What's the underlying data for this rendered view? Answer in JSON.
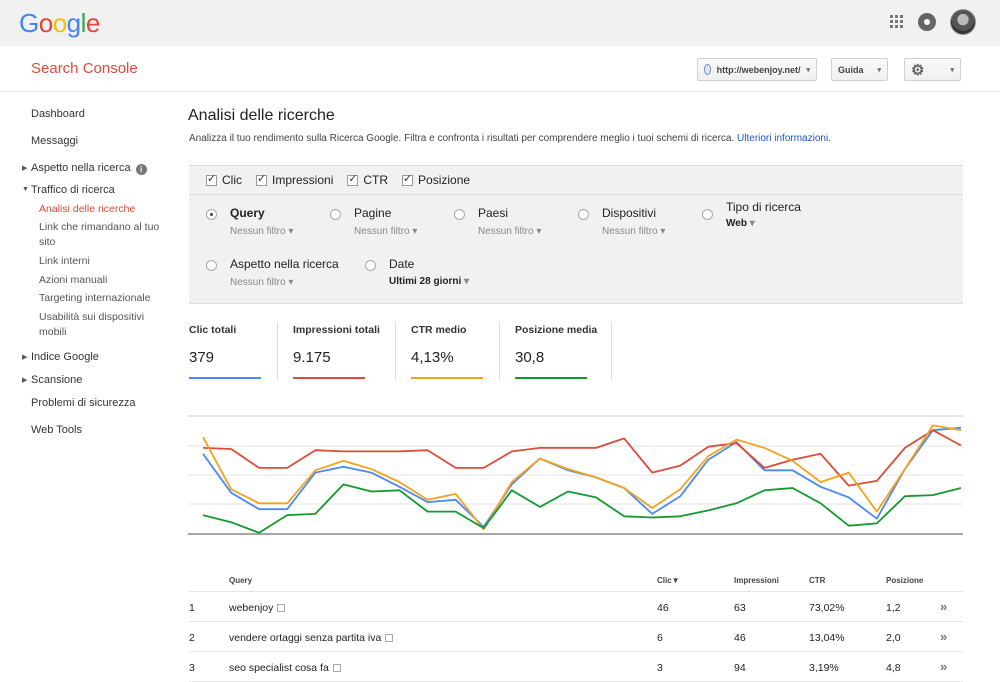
{
  "header": {
    "logo": [
      "G",
      "o",
      "o",
      "g",
      "l",
      "e"
    ],
    "logo_colors": [
      "#4285f4",
      "#ea4335",
      "#fbbc05",
      "#4285f4",
      "#34a853",
      "#ea4335"
    ],
    "icons": [
      "apps-grid-icon",
      "notifications-icon",
      "account-avatar"
    ]
  },
  "subheader": {
    "product": "Search Console",
    "site": "http://webenjoy.net/",
    "help": "Guida",
    "settings_icon": "gear-icon"
  },
  "sidebar": {
    "items": [
      {
        "label": "Dashboard"
      },
      {
        "label": "Messaggi"
      },
      {
        "label": "Aspetto nella ricerca"
      },
      {
        "label": "Traffico di ricerca"
      },
      {
        "label": "Analisi delle ricerche"
      },
      {
        "label": "Link che rimandano al tuo"
      },
      {
        "label": "sito"
      },
      {
        "label": "Link interni"
      },
      {
        "label": "Azioni manuali"
      },
      {
        "label": "Targeting internazionale"
      },
      {
        "label": "Usabilità sui dispositivi"
      },
      {
        "label": "mobili"
      },
      {
        "label": "Indice Google"
      },
      {
        "label": "Scansione"
      },
      {
        "label": "Problemi di sicurezza"
      },
      {
        "label": "Web Tools"
      }
    ],
    "info": "i"
  },
  "page": {
    "title": "Analisi delle ricerche",
    "description": "Analizza il tuo rendimento sulla Ricerca Google. Filtra e confronta i risultati per comprendere meglio i tuoi schemi di ricerca. ",
    "more_link": "Ulteriori informazioni."
  },
  "metrics_toggles": [
    "Clic",
    "Impressioni",
    "CTR",
    "Posizione"
  ],
  "groups": [
    {
      "label": "Query",
      "filter": "Nessun filtro",
      "selected": true
    },
    {
      "label": "Pagine",
      "filter": "Nessun filtro",
      "selected": false
    },
    {
      "label": "Paesi",
      "filter": "Nessun filtro",
      "selected": false
    },
    {
      "label": "Dispositivi",
      "filter": "Nessun filtro",
      "selected": false
    },
    {
      "label": "Tipo di ricerca",
      "filter": "Web",
      "selected": false
    },
    {
      "label": "Aspetto nella ricerca",
      "filter": "Nessun filtro",
      "selected": false
    },
    {
      "label": "Date",
      "filter": "Ultimi 28 giorni",
      "selected": false
    }
  ],
  "caret": "▾",
  "totals": [
    {
      "label": "Clic totali",
      "value": "379",
      "color": "#4a8af4"
    },
    {
      "label": "Impressioni totali",
      "value": "9.175",
      "color": "#dd4b39"
    },
    {
      "label": "CTR medio",
      "value": "4,13%",
      "color": "#f4a21d"
    },
    {
      "label": "Posizione media",
      "value": "30,8",
      "color": "#129a2f"
    }
  ],
  "chart_data": {
    "type": "line",
    "days": 28,
    "series": [
      {
        "color": "#4a8af4",
        "values": [
          0.68,
          0.35,
          0.21,
          0.21,
          0.52,
          0.57,
          0.52,
          0.4,
          0.27,
          0.29,
          0.06,
          0.42,
          0.64,
          0.54,
          0.48,
          0.39,
          0.17,
          0.32,
          0.63,
          0.78,
          0.54,
          0.54,
          0.4,
          0.31,
          0.13,
          0.55,
          0.88,
          0.9
        ]
      },
      {
        "color": "#dd4b39",
        "values": [
          0.73,
          0.72,
          0.56,
          0.56,
          0.71,
          0.7,
          0.7,
          0.7,
          0.71,
          0.56,
          0.56,
          0.7,
          0.73,
          0.73,
          0.73,
          0.81,
          0.52,
          0.58,
          0.74,
          0.77,
          0.56,
          0.63,
          0.68,
          0.41,
          0.45,
          0.73,
          0.88,
          0.75
        ]
      },
      {
        "color": "#f4a21d",
        "values": [
          0.82,
          0.38,
          0.26,
          0.26,
          0.54,
          0.62,
          0.55,
          0.44,
          0.29,
          0.34,
          0.04,
          0.44,
          0.64,
          0.55,
          0.48,
          0.39,
          0.22,
          0.38,
          0.66,
          0.8,
          0.73,
          0.62,
          0.44,
          0.52,
          0.19,
          0.55,
          0.92,
          0.88
        ]
      },
      {
        "color": "#129a2f",
        "values": [
          0.16,
          0.1,
          0.01,
          0.16,
          0.17,
          0.42,
          0.36,
          0.37,
          0.19,
          0.19,
          0.05,
          0.37,
          0.23,
          0.36,
          0.31,
          0.15,
          0.14,
          0.15,
          0.2,
          0.26,
          0.37,
          0.39,
          0.26,
          0.07,
          0.09,
          0.32,
          0.33,
          0.39
        ]
      }
    ]
  },
  "table": {
    "headers": {
      "query": "Query",
      "clicks": "Clic▼",
      "impressions": "Impressioni",
      "ctr": "CTR",
      "position": "Posizione"
    },
    "rows": [
      {
        "n": "1",
        "query": "webenjoy",
        "clicks": "46",
        "impressions": "63",
        "ctr": "73,02%",
        "position": "1,2"
      },
      {
        "n": "2",
        "query": "vendere ortaggi senza partita iva",
        "clicks": "6",
        "impressions": "46",
        "ctr": "13,04%",
        "position": "2,0"
      },
      {
        "n": "3",
        "query": "seo specialist cosa fa",
        "clicks": "3",
        "impressions": "94",
        "ctr": "3,19%",
        "position": "4,8"
      }
    ],
    "row_action": "»"
  }
}
